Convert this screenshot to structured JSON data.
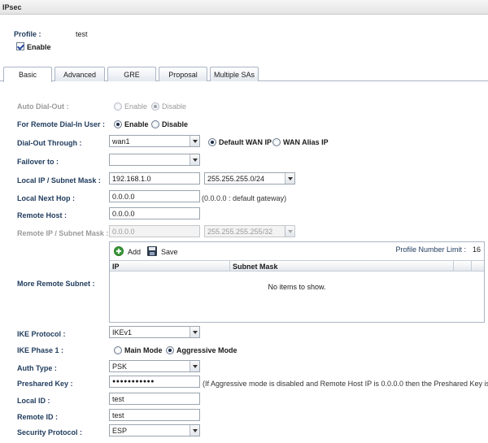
{
  "window": {
    "title": "IPsec"
  },
  "profile": {
    "label": "Profile :",
    "value": "test",
    "enable_label": "Enable"
  },
  "tabs": [
    {
      "label": "Basic"
    },
    {
      "label": "Advanced"
    },
    {
      "label": "GRE"
    },
    {
      "label": "Proposal"
    },
    {
      "label": "Multiple SAs"
    }
  ],
  "form": {
    "auto_dialout": {
      "label": "Auto Dial-Out :",
      "opt_enable": "Enable",
      "opt_disable": "Disable"
    },
    "remote_dialin": {
      "label": "For Remote Dial-In User :",
      "opt_enable": "Enable",
      "opt_disable": "Disable"
    },
    "dialout_through": {
      "label": "Dial-Out Through :",
      "value": "wan1",
      "opt_default": "Default WAN IP",
      "opt_alias": "WAN Alias IP"
    },
    "failover": {
      "label": "Failover to :",
      "value": ""
    },
    "local_ip": {
      "label": "Local IP / Subnet Mask :",
      "ip": "192.168.1.0",
      "mask": "255.255.255.0/24"
    },
    "local_next_hop": {
      "label": "Local Next Hop :",
      "value": "0.0.0.0",
      "hint": "(0.0.0.0 : default gateway)"
    },
    "remote_host": {
      "label": "Remote Host :",
      "value": "0.0.0.0"
    },
    "remote_ip": {
      "label": "Remote IP / Subnet Mask :",
      "ip": "0.0.0.0",
      "mask": "255.255.255.255/32"
    },
    "more_subnet": {
      "label": "More Remote Subnet :",
      "add_label": "Add",
      "save_label": "Save",
      "limit_label": "Profile Number Limit :",
      "limit_value": "16",
      "col_ip": "IP",
      "col_mask": "Subnet Mask",
      "empty_text": "No items to show."
    },
    "ike_protocol": {
      "label": "IKE Protocol :",
      "value": "IKEv1"
    },
    "ike_phase1": {
      "label": "IKE Phase 1 :",
      "opt_main": "Main Mode",
      "opt_aggressive": "Aggressive Mode"
    },
    "auth_type": {
      "label": "Auth Type :",
      "value": "PSK"
    },
    "preshared_key": {
      "label": "Preshared Key :",
      "value": "●●●●●●●●●●●",
      "hint": "(If Aggressive mode is disabled and Remote Host IP is 0.0.0.0 then the Preshared Key is instead"
    },
    "local_id": {
      "label": "Local ID :",
      "value": "test"
    },
    "remote_id": {
      "label": "Remote ID :",
      "value": "test"
    },
    "security_protocol": {
      "label": "Security Protocol :",
      "value": "ESP"
    }
  }
}
